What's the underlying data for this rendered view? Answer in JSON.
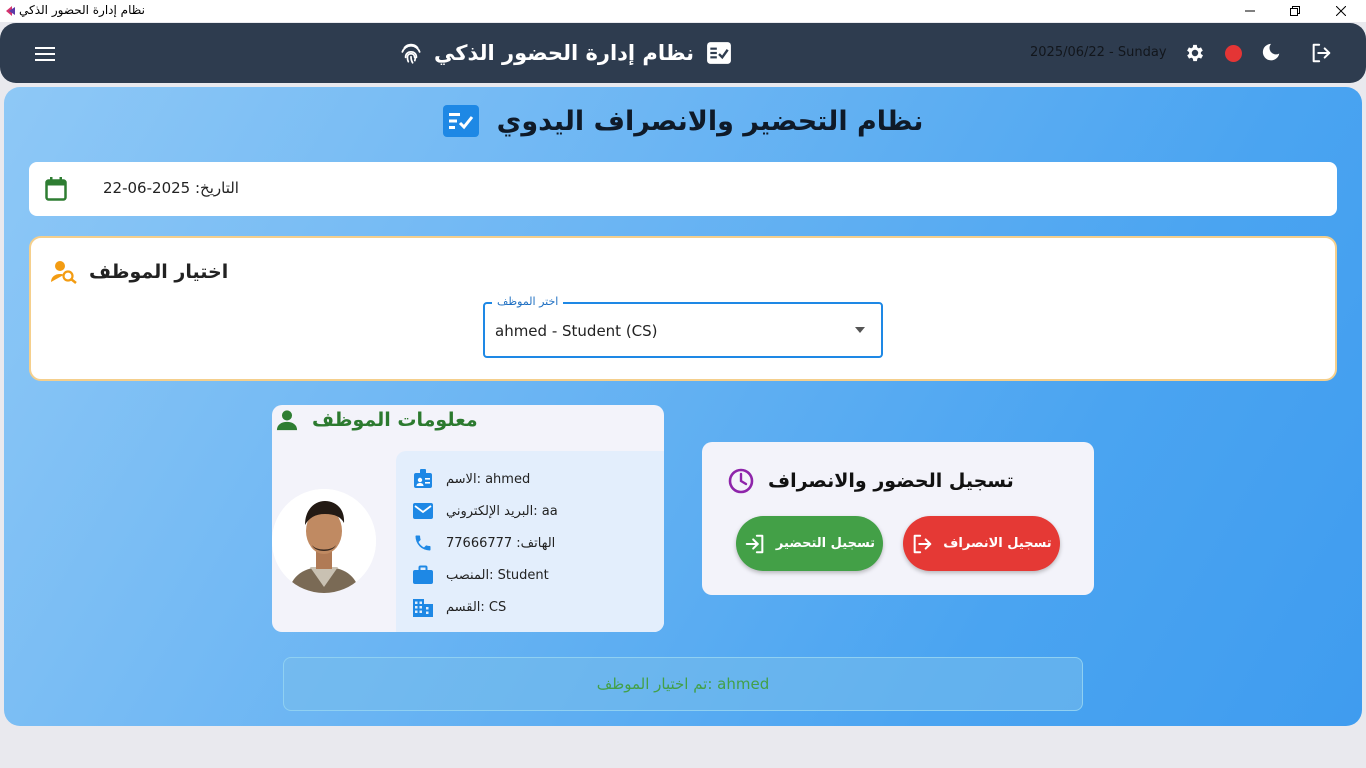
{
  "window": {
    "title": "نظام إدارة الحضور الذكي",
    "controls": [
      "minimize",
      "maximize",
      "close"
    ]
  },
  "appbar": {
    "title": "نظام إدارة الحضور الذكي",
    "date": "2025/06/22 - Sunday",
    "icons": [
      "menu-icon",
      "fingerprint-icon",
      "task-icon",
      "settings-icon",
      "status-dot",
      "dark-mode-icon",
      "logout-icon"
    ],
    "status_color": "#e43535"
  },
  "page": {
    "title": "نظام التحضير والانصراف اليدوي",
    "date_label": "التاريخ: 2025-06-22"
  },
  "employee_select": {
    "heading": "اختيار الموظف",
    "field_label": "اختر الموظف",
    "value": "ahmed - Student (CS)"
  },
  "employee_info": {
    "heading": "معلومات الموظف",
    "rows": [
      {
        "icon": "badge-icon",
        "text": "الاسم: ahmed"
      },
      {
        "icon": "email-icon",
        "text": "البريد الإلكتروني: aa"
      },
      {
        "icon": "phone-icon",
        "text": "الهاتف: 77666777"
      },
      {
        "icon": "briefcase-icon",
        "text": "المنصب: Student"
      },
      {
        "icon": "building-icon",
        "text": "القسم: CS"
      }
    ]
  },
  "attendance": {
    "heading": "تسجيل الحضور والانصراف",
    "checkin_label": "تسجيل التحضير",
    "checkout_label": "تسجيل الانصراف"
  },
  "status": {
    "message": "تم اختيار الموظف: ahmed"
  },
  "colors": {
    "appbar": "#2e3c4f",
    "checkin": "#43a047",
    "checkout": "#e53935",
    "accent": "#1e88e5",
    "warning_border": "#f5cf8c"
  }
}
